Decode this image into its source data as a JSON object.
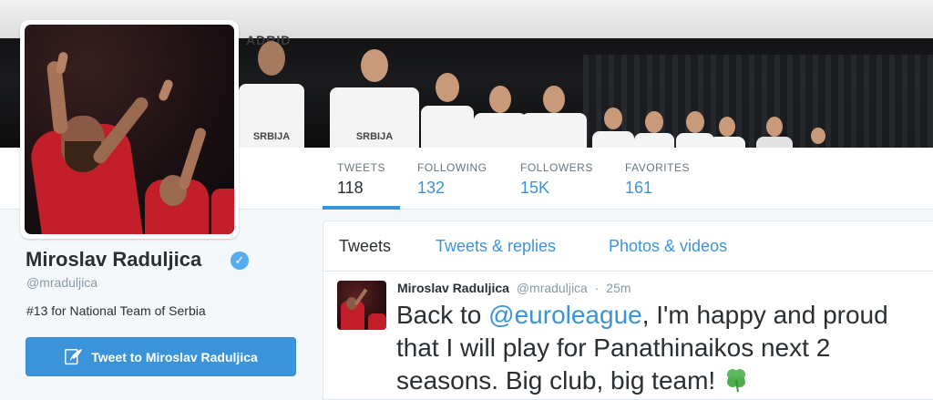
{
  "banner": {
    "wall_text": "ADRID",
    "jersey_text": "SRBIJA"
  },
  "profile": {
    "name": "Miroslav Raduljica",
    "handle": "@mraduljica",
    "bio": "#13 for National Team of Serbia",
    "tweet_to_label": "Tweet to Miroslav Raduljica"
  },
  "stats": [
    {
      "label": "TWEETS",
      "value": "118"
    },
    {
      "label": "FOLLOWING",
      "value": "132"
    },
    {
      "label": "FOLLOWERS",
      "value": "15K"
    },
    {
      "label": "FAVORITES",
      "value": "161"
    }
  ],
  "tabs": [
    {
      "label": "Tweets"
    },
    {
      "label": "Tweets & replies"
    },
    {
      "label": "Photos & videos"
    }
  ],
  "tweet": {
    "name": "Miroslav Raduljica",
    "handle": "@mraduljica",
    "separator": "·",
    "time": "25m",
    "text_before": "Back to ",
    "mention": "@euroleague",
    "text_after": ", I'm happy and proud that I will play for Panathinaikos next 2 seasons. Big club, big team! "
  },
  "colors": {
    "accent": "#3b94d9",
    "verified": "#55acee",
    "clover": "#5cb85c"
  },
  "icons": [
    "verified-badge-icon",
    "feather-icon",
    "four-leaf-clover-icon"
  ]
}
